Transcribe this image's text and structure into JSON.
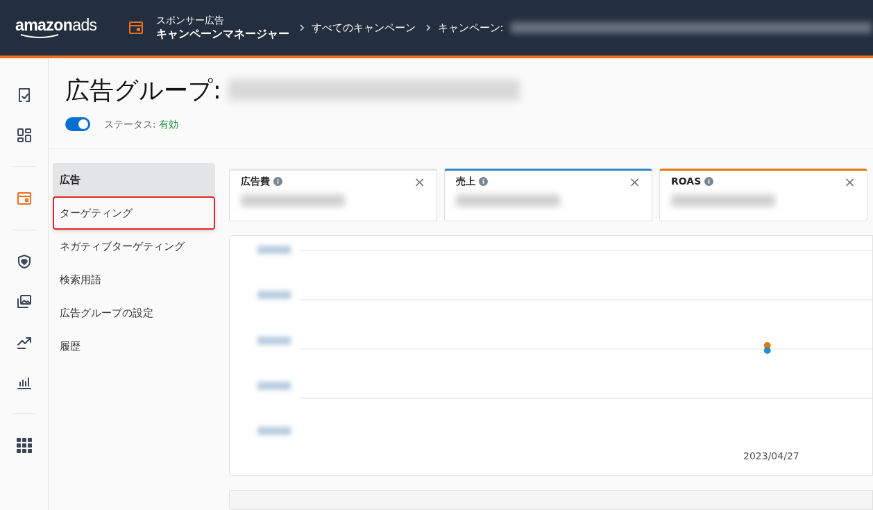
{
  "header": {
    "logo": {
      "word1": "amazon",
      "word2": "ads"
    },
    "product": {
      "line1": "スポンサー広告",
      "line2": "キャンペーンマネージャー"
    },
    "breadcrumbs": [
      {
        "label": "すべてのキャンペーン"
      },
      {
        "label": "キャンペーン:"
      }
    ]
  },
  "rail": [
    {
      "kind": "check-doc",
      "selected": false
    },
    {
      "kind": "grid",
      "selected": false
    },
    {
      "kind": "card",
      "selected": true
    },
    {
      "kind": "shield",
      "selected": false
    },
    {
      "kind": "images",
      "selected": false
    },
    {
      "kind": "trend",
      "selected": false
    },
    {
      "kind": "bars",
      "selected": false
    },
    {
      "kind": "apps",
      "selected": false
    }
  ],
  "page": {
    "title": "広告グループ:",
    "status": {
      "on": true,
      "label": "ステータス:",
      "value": "有効"
    }
  },
  "nav": [
    {
      "label": "広告",
      "selected": true,
      "highlighted": false
    },
    {
      "label": "ターゲティング",
      "selected": false,
      "highlighted": true
    },
    {
      "label": "ネガティブターゲティング",
      "selected": false,
      "highlighted": false
    },
    {
      "label": "検索用語",
      "selected": false,
      "highlighted": false
    },
    {
      "label": "広告グループの設定",
      "selected": false,
      "highlighted": false
    },
    {
      "label": "履歴",
      "selected": false,
      "highlighted": false
    }
  ],
  "metrics": [
    {
      "label": "広告費",
      "close": "×",
      "color": "#e6e6e6"
    },
    {
      "label": "売上",
      "close": "×",
      "color": "#2e8bc0"
    },
    {
      "label": "ROAS",
      "close": "×",
      "color": "#e07a10"
    }
  ],
  "chart": {
    "x_label": "2023/04/27"
  }
}
